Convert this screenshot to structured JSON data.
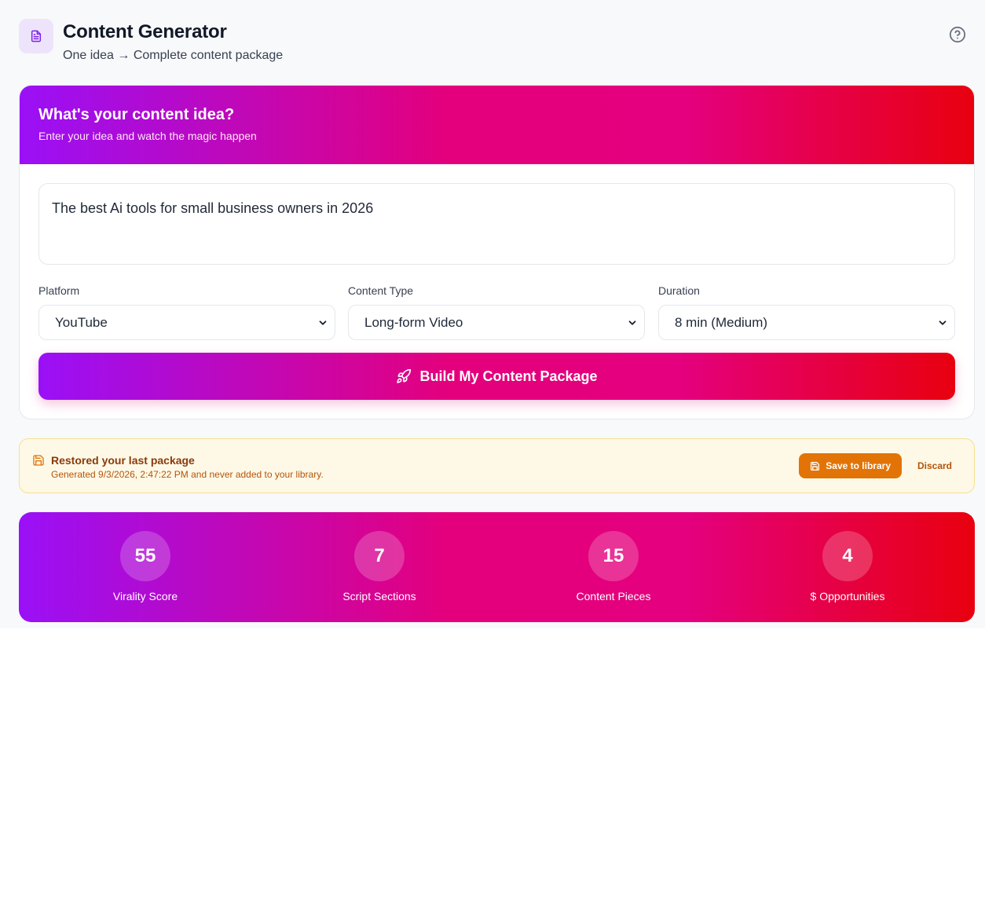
{
  "header": {
    "title": "Content Generator",
    "subtitle": "One idea → Complete content package",
    "logo_icon": "document-icon",
    "help_icon": "help-circle-icon"
  },
  "idea_card": {
    "heading": "What's your content idea?",
    "subheading": "Enter your idea and watch the magic happen",
    "idea_value": "The best Ai tools for small business owners in 2026",
    "fields": {
      "platform": {
        "label": "Platform",
        "value": "YouTube"
      },
      "content_type": {
        "label": "Content Type",
        "value": "Long-form Video"
      },
      "duration": {
        "label": "Duration",
        "value": "8 min (Medium)"
      }
    },
    "build_label": "Build My Content Package",
    "build_icon": "rocket-icon"
  },
  "restore_banner": {
    "title": "Restored your last package",
    "subtitle": "Generated 9/3/2026, 2:47:22 PM and never added to your library.",
    "save_label": "Save to library",
    "discard_label": "Discard"
  },
  "stats": [
    {
      "value": "55",
      "label": "Virality Score"
    },
    {
      "value": "7",
      "label": "Script Sections"
    },
    {
      "value": "15",
      "label": "Content Pieces"
    },
    {
      "value": "4",
      "label": "$ Opportunities"
    }
  ],
  "colors": {
    "gradient_start": "#9a10f7",
    "gradient_mid": "#e4007c",
    "gradient_end": "#e8000f",
    "banner_bg": "#fef9e6",
    "banner_button": "#e27407"
  }
}
